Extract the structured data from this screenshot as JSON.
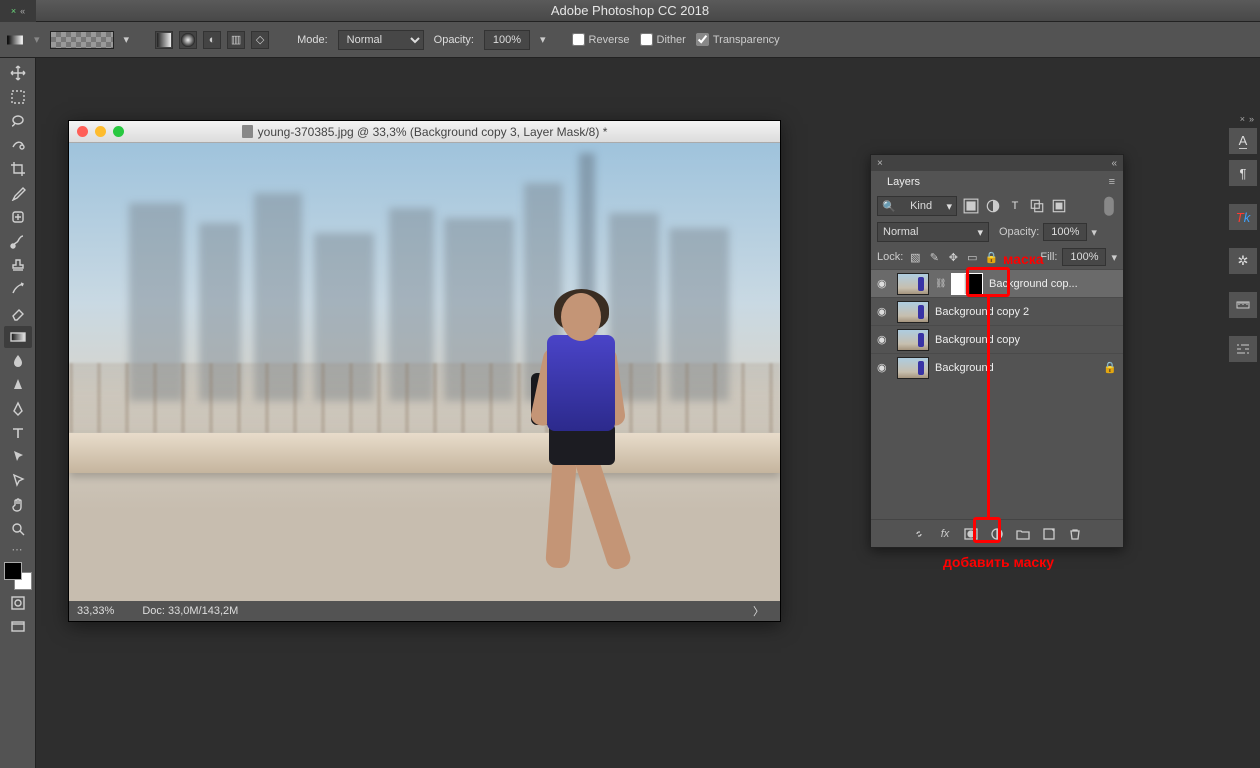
{
  "app_title": "Adobe Photoshop CC 2018",
  "options_bar": {
    "mode_label": "Mode:",
    "mode_value": "Normal",
    "opacity_label": "Opacity:",
    "opacity_value": "100%",
    "reverse_label": "Reverse",
    "dither_label": "Dither",
    "transparency_label": "Transparency",
    "reverse_checked": false,
    "dither_checked": false,
    "transparency_checked": true
  },
  "document": {
    "title": "young-370385.jpg @ 33,3% (Background copy 3, Layer Mask/8) *",
    "zoom": "33,33%",
    "doc_info": "Doc: 33,0M/143,2M"
  },
  "layers_panel": {
    "title": "Layers",
    "kind_label": "Kind",
    "blend_mode": "Normal",
    "opacity_label": "Opacity:",
    "opacity_value": "100%",
    "lock_label": "Lock:",
    "fill_label": "Fill:",
    "fill_value": "100%",
    "layers": [
      {
        "name": "Background cop...",
        "has_mask": true,
        "selected": true,
        "locked": false
      },
      {
        "name": "Background copy 2",
        "has_mask": false,
        "selected": false,
        "locked": false
      },
      {
        "name": "Background copy",
        "has_mask": false,
        "selected": false,
        "locked": false
      },
      {
        "name": "Background",
        "has_mask": false,
        "selected": false,
        "locked": true
      }
    ]
  },
  "annotations": {
    "mask_label": "маска",
    "add_mask_label": "добавить маску"
  }
}
